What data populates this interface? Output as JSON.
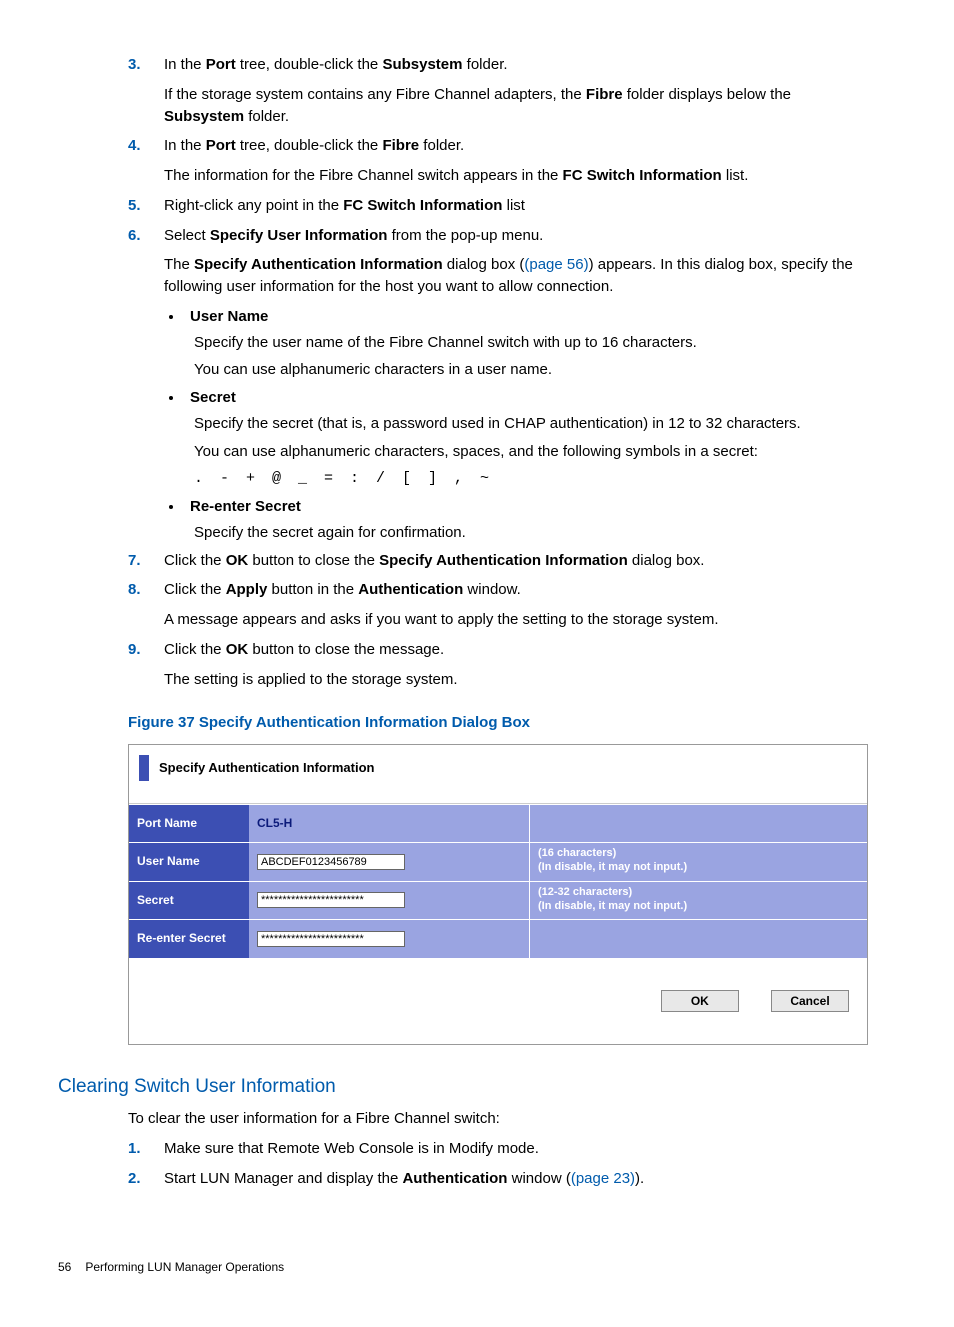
{
  "steps_a": [
    {
      "n": "3",
      "parts": [
        {
          "t": "text",
          "v": "In the "
        },
        {
          "t": "bold",
          "v": "Port"
        },
        {
          "t": "text",
          "v": " tree, double-click the "
        },
        {
          "t": "bold",
          "v": "Subsystem"
        },
        {
          "t": "text",
          "v": " folder."
        }
      ],
      "after": [
        {
          "parts": [
            {
              "t": "text",
              "v": "If the storage system contains any Fibre Channel adapters, the "
            },
            {
              "t": "bold",
              "v": "Fibre"
            },
            {
              "t": "text",
              "v": " folder displays below the "
            },
            {
              "t": "bold",
              "v": "Subsystem"
            },
            {
              "t": "text",
              "v": " folder."
            }
          ]
        }
      ]
    },
    {
      "n": "4",
      "parts": [
        {
          "t": "text",
          "v": "In the "
        },
        {
          "t": "bold",
          "v": "Port"
        },
        {
          "t": "text",
          "v": " tree, double-click the "
        },
        {
          "t": "bold",
          "v": "Fibre"
        },
        {
          "t": "text",
          "v": " folder."
        }
      ],
      "after": [
        {
          "parts": [
            {
              "t": "text",
              "v": "The information for the Fibre Channel switch appears in the "
            },
            {
              "t": "bold",
              "v": "FC Switch Information"
            },
            {
              "t": "text",
              "v": " list."
            }
          ]
        }
      ]
    },
    {
      "n": "5",
      "parts": [
        {
          "t": "text",
          "v": "Right-click any point in the "
        },
        {
          "t": "bold",
          "v": "FC Switch Information"
        },
        {
          "t": "text",
          "v": " list"
        }
      ]
    },
    {
      "n": "6",
      "parts": [
        {
          "t": "text",
          "v": "Select "
        },
        {
          "t": "bold",
          "v": "Specify User Information"
        },
        {
          "t": "text",
          "v": " from the pop-up menu."
        }
      ],
      "after": [
        {
          "parts": [
            {
              "t": "text",
              "v": "The "
            },
            {
              "t": "bold",
              "v": "Specify Authentication Information"
            },
            {
              "t": "text",
              "v": " dialog box ("
            },
            {
              "t": "link",
              "v": "(page 56)"
            },
            {
              "t": "text",
              "v": ") appears. In this dialog box, specify the following user information for the host you want to allow connection."
            }
          ]
        }
      ]
    }
  ],
  "bullets": [
    {
      "title": "User Name",
      "paras": [
        "Specify the user name of the Fibre Channel switch with up to 16 characters.",
        "You can use alphanumeric characters in a user name."
      ]
    },
    {
      "title": "Secret",
      "paras": [
        "Specify the secret (that is, a password used in CHAP authentication) in 12 to 32 characters.",
        "You can use alphanumeric characters, spaces, and the following symbols in a secret:"
      ],
      "code": ". - + @ _ = : / [ ] , ~"
    },
    {
      "title": "Re-enter Secret",
      "paras": [
        "Specify the secret again for confirmation."
      ]
    }
  ],
  "steps_b": [
    {
      "n": "7",
      "parts": [
        {
          "t": "text",
          "v": "Click the "
        },
        {
          "t": "bold",
          "v": "OK"
        },
        {
          "t": "text",
          "v": " button to close the "
        },
        {
          "t": "bold",
          "v": "Specify Authentication Information"
        },
        {
          "t": "text",
          "v": " dialog box."
        }
      ]
    },
    {
      "n": "8",
      "parts": [
        {
          "t": "text",
          "v": "Click the "
        },
        {
          "t": "bold",
          "v": "Apply"
        },
        {
          "t": "text",
          "v": " button in the "
        },
        {
          "t": "bold",
          "v": "Authentication"
        },
        {
          "t": "text",
          "v": " window."
        }
      ],
      "after": [
        {
          "parts": [
            {
              "t": "text",
              "v": "A message appears and asks if you want to apply the setting to the storage system."
            }
          ]
        }
      ]
    },
    {
      "n": "9",
      "parts": [
        {
          "t": "text",
          "v": "Click the "
        },
        {
          "t": "bold",
          "v": "OK"
        },
        {
          "t": "text",
          "v": " button to close the message."
        }
      ],
      "after": [
        {
          "parts": [
            {
              "t": "text",
              "v": "The setting is applied to the storage system."
            }
          ]
        }
      ]
    }
  ],
  "figure_caption": "Figure 37 Specify Authentication Information Dialog Box",
  "dialog": {
    "title": "Specify Authentication Information",
    "rows": [
      {
        "label": "Port Name",
        "static": "CL5-H",
        "hint": ""
      },
      {
        "label": "User Name",
        "value": "ABCDEF0123456789",
        "hint": "(16 characters)\n(In disable, it may not input.)"
      },
      {
        "label": "Secret",
        "value": "************************",
        "hint": "(12-32 characters)\n(In disable, it may not input.)"
      },
      {
        "label": "Re-enter Secret",
        "value": "************************",
        "hint": ""
      }
    ],
    "ok": "OK",
    "cancel": "Cancel"
  },
  "section_title": "Clearing Switch User Information",
  "section_lead": "To clear the user information for a Fibre Channel switch:",
  "steps_c": [
    {
      "n": "1",
      "parts": [
        {
          "t": "text",
          "v": "Make sure that Remote Web Console is in Modify mode."
        }
      ]
    },
    {
      "n": "2",
      "parts": [
        {
          "t": "text",
          "v": "Start LUN Manager and display the "
        },
        {
          "t": "bold",
          "v": "Authentication"
        },
        {
          "t": "text",
          "v": " window ("
        },
        {
          "t": "link",
          "v": "(page 23)"
        },
        {
          "t": "text",
          "v": ")."
        }
      ]
    }
  ],
  "footer": {
    "page": "56",
    "title": "Performing LUN Manager Operations"
  }
}
